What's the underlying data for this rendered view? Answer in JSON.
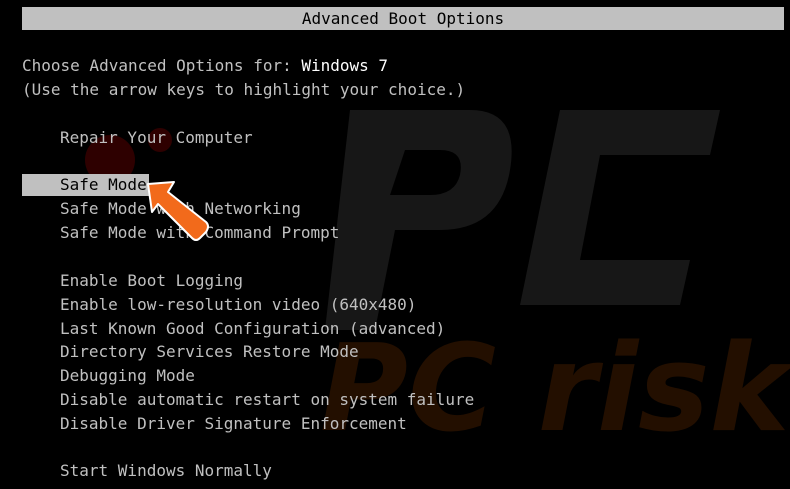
{
  "title": "Advanced Boot Options",
  "prompt": {
    "prefix": "Choose Advanced Options for: ",
    "os": "Windows 7",
    "hint": "(Use the arrow keys to highlight your choice.)"
  },
  "groups": {
    "repair": [
      "Repair Your Computer"
    ],
    "safe": [
      "Safe Mode",
      "Safe Mode with Networking",
      "Safe Mode with Command Prompt"
    ],
    "advanced": [
      "Enable Boot Logging",
      "Enable low-resolution video (640x480)",
      "Last Known Good Configuration (advanced)",
      "Directory Services Restore Mode",
      "Debugging Mode",
      "Disable automatic restart on system failure",
      "Disable Driver Signature Enforcement"
    ],
    "normal": [
      "Start Windows Normally"
    ]
  },
  "selected": "Safe Mode",
  "colors": {
    "background": "#000000",
    "text": "#c0c0c0",
    "highlight": "#c0c0c0",
    "arrow": "#f26a1b"
  },
  "watermark": {
    "text": "PC risk.com"
  }
}
